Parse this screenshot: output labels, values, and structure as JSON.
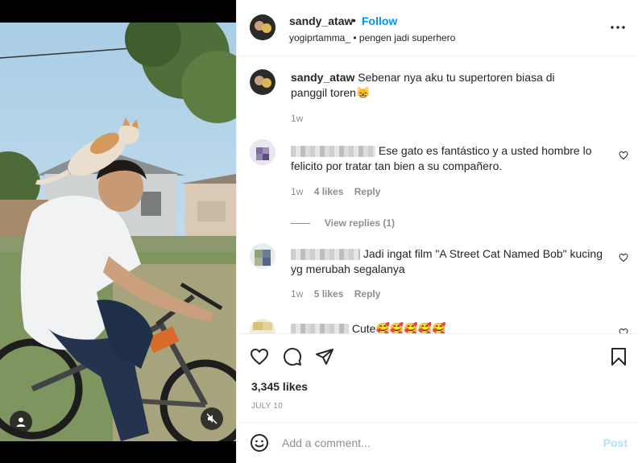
{
  "header": {
    "username": "sandy_ataw",
    "separator": "•",
    "follow_label": "Follow",
    "audio_user": "yogiprtamma_",
    "audio_title": "pengen jadi superhero",
    "more_icon": "more-horizontal-icon"
  },
  "caption": {
    "username": "sandy_ataw",
    "text": "Sebenar nya aku tu supertoren biasa di panggil toren😸",
    "time": "1w"
  },
  "comments": [
    {
      "text": "Ese gato es fantástico y a usted hombre lo felicito por tratar tan bien a su compañero.",
      "time": "1w",
      "likes": "4 likes",
      "reply": "Reply",
      "view_replies": "View replies (1)"
    },
    {
      "text": "Jadi ingat film \"A Street Cat Named Bob\" kucing yg merubah segalanya",
      "time": "1w",
      "likes": "5 likes",
      "reply": "Reply"
    },
    {
      "text": "Cute🥰🥰🥰🥰🥰"
    }
  ],
  "actions": {
    "icons": [
      "heart-icon",
      "comment-icon",
      "share-icon",
      "bookmark-icon"
    ],
    "likes": "3,345 likes",
    "date": "JULY 10"
  },
  "add_comment": {
    "placeholder": "Add a comment...",
    "post_label": "Post",
    "emoji_icon": "emoji-icon"
  },
  "media": {
    "user_tag_icon": "user-tag-icon",
    "mute_icon": "muted-speaker-icon"
  },
  "colors": {
    "accent": "#0095f6",
    "post_disabled": "#b2dffc",
    "muted_text": "#8e8e8e",
    "text": "#262626",
    "divider": "#efefef"
  }
}
